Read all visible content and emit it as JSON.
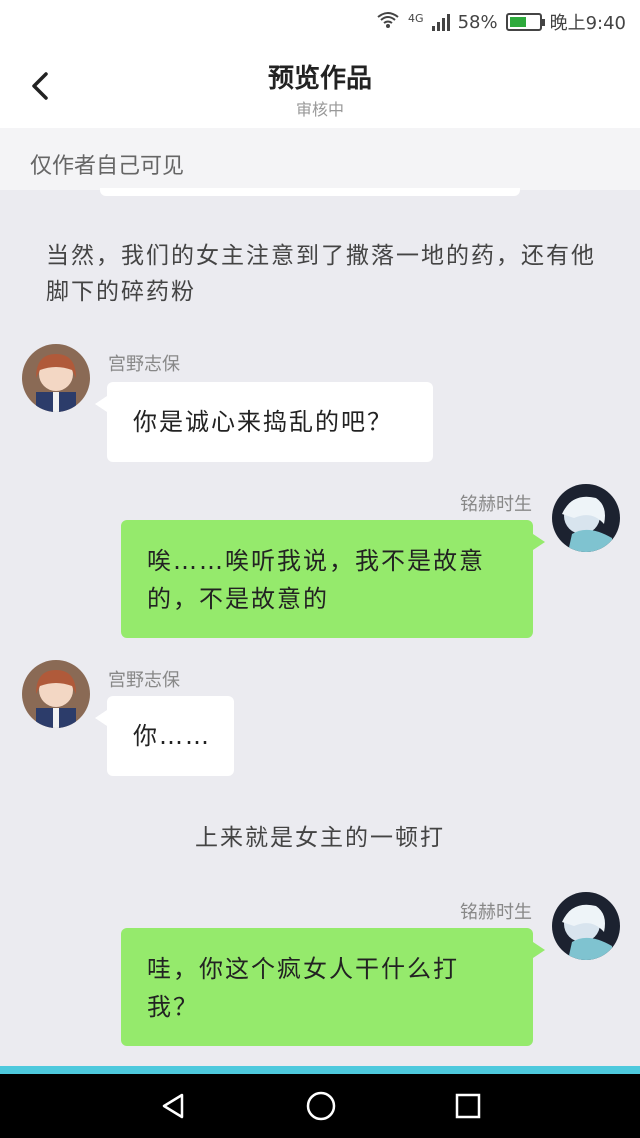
{
  "status": {
    "network": "4G",
    "battery": "58%",
    "battery_level": 0.58,
    "time": "晚上9:40"
  },
  "header": {
    "title": "预览作品",
    "subtitle": "审核中"
  },
  "notice": "仅作者自己可见",
  "messages": [
    {
      "type": "narration",
      "text": "当然，我们的女主注意到了撒落一地的药，还有他脚下的碎药粉"
    },
    {
      "type": "left",
      "name": "宫野志保",
      "text": "你是诚心来捣乱的吧？"
    },
    {
      "type": "right",
      "name": "铭赫时生",
      "text": "唉……唉听我说，我不是故意的，不是故意的"
    },
    {
      "type": "left",
      "name": "宫野志保",
      "text": "你……"
    },
    {
      "type": "narration",
      "text": "上来就是女主的一顿打"
    },
    {
      "type": "right",
      "name": "铭赫时生",
      "text": "哇，你这个疯女人干什么打我？"
    }
  ],
  "icons": {
    "back": "chevron-left-icon",
    "nav_back": "triangle-back-icon",
    "nav_home": "circle-home-icon",
    "nav_recent": "square-recent-icon"
  },
  "colors": {
    "green_bubble": "#95ea6c",
    "white_bubble": "#ffffff",
    "background": "#ebebf0",
    "accent": "#4ec9dd"
  }
}
